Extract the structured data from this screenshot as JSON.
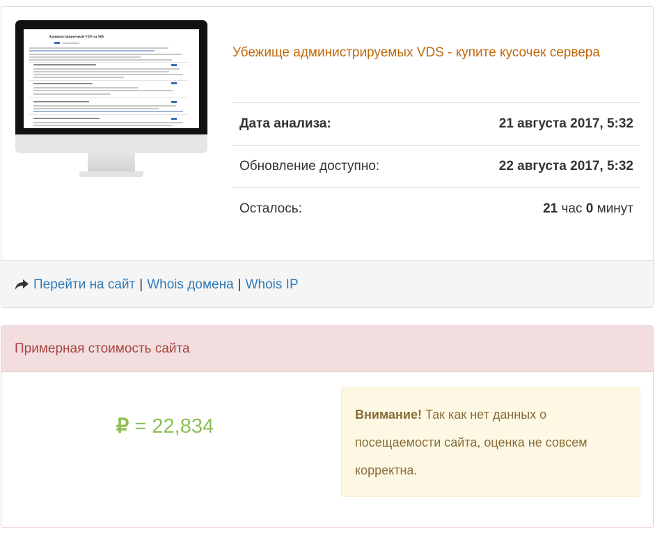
{
  "site": {
    "title": "Убежище администрируемых VDS - купите кусочек сервера",
    "screenshot_title": "Администрируемый VDS за 96$"
  },
  "info": {
    "analysis_label": "Дата анализа:",
    "analysis_value": "21 августа 2017, 5:32",
    "update_label": "Обновление доступно:",
    "update_value": "22 августа 2017, 5:32",
    "remaining_label": "Осталось:",
    "remaining_hours": "21",
    "hours_unit": "час",
    "remaining_minutes": "0",
    "minutes_unit": "минут"
  },
  "links": {
    "go_to_site": "Перейти на сайт",
    "separator": "|",
    "whois_domain": "Whois домена",
    "whois_ip": "Whois IP"
  },
  "cost": {
    "heading": "Примерная стоимость сайта",
    "currency_symbol": "₽",
    "equals": "=",
    "amount": "22,834",
    "warning_strong": "Внимание!",
    "warning_text": "Так как нет данных о посещаемости сайта, оценка не совсем корректна."
  },
  "colors": {
    "title_orange": "#c0690b",
    "link_blue": "#337ab7",
    "danger_text": "#a94442",
    "danger_bg": "#f2dede",
    "price_green": "#8cc152",
    "warning_bg": "#fcf8e3",
    "warning_text": "#8a6d3b"
  },
  "icons": {
    "go_to_site": "share-arrow-icon"
  }
}
